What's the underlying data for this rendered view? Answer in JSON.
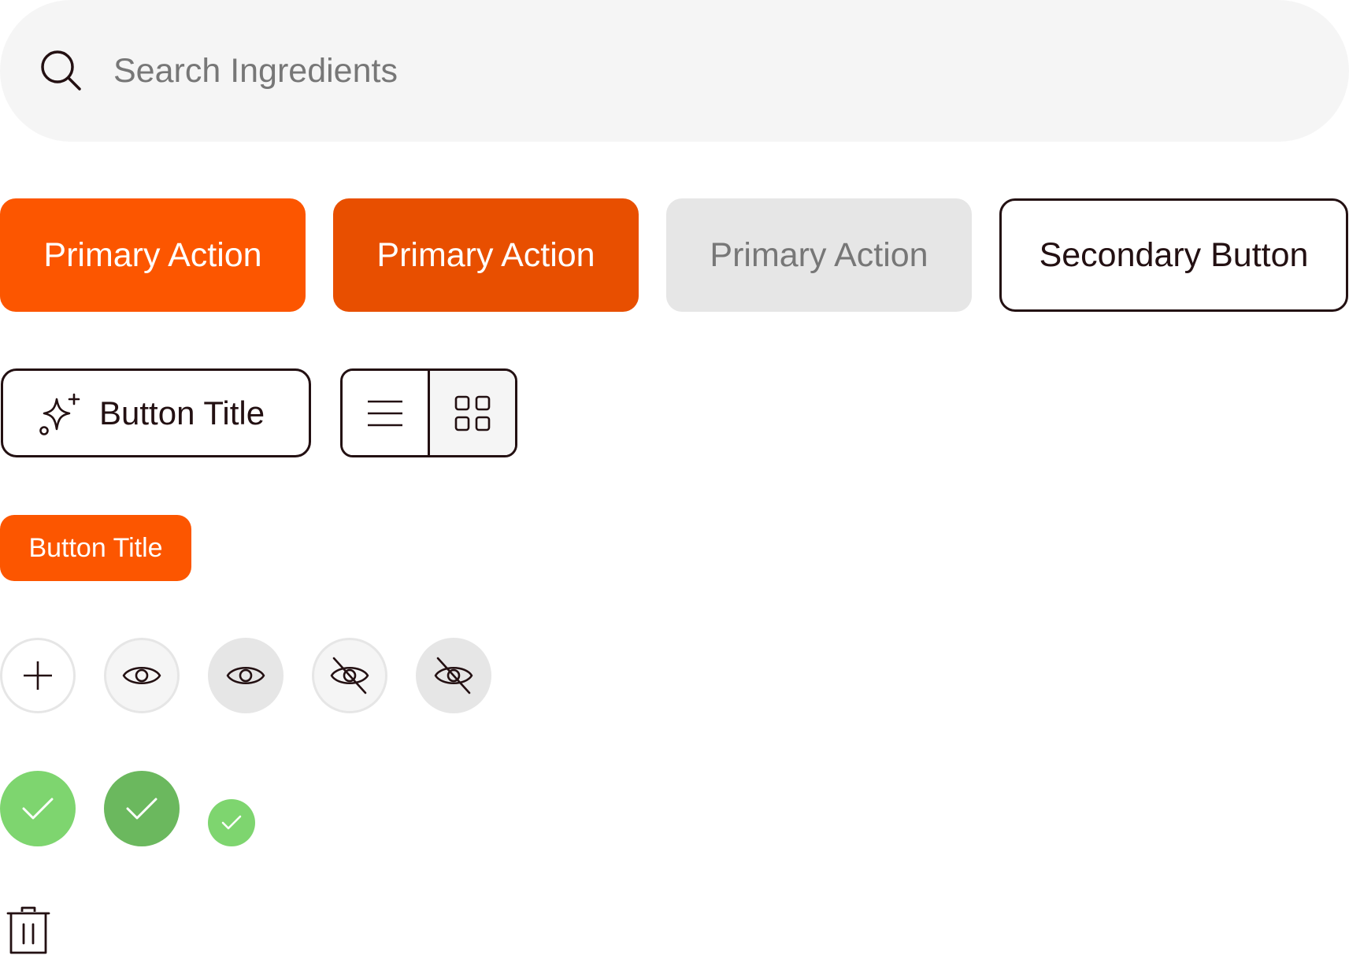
{
  "search": {
    "placeholder": "Search Ingredients",
    "icon": "search-icon"
  },
  "buttons": {
    "primary_default": "Primary Action",
    "primary_hover": "Primary Action",
    "primary_disabled": "Primary Action",
    "secondary": "Secondary Button",
    "icon_title": "Button Title",
    "chip": "Button Title"
  },
  "icons": {
    "sparkle": "sparkle-icon",
    "list": "list-icon",
    "grid": "grid-icon",
    "plus": "plus-icon",
    "eye": "eye-icon",
    "eye_off": "eye-off-icon",
    "check": "check-icon",
    "trash": "trash-icon"
  },
  "colors": {
    "primary": "#fc5600",
    "primary_hover": "#e84f00",
    "disabled_bg": "#e6e6e6",
    "disabled_text": "#777777",
    "ink": "#231012",
    "search_bg": "#f5f5f5",
    "success": "#7ed56f",
    "success_dark": "#6bb85e"
  }
}
